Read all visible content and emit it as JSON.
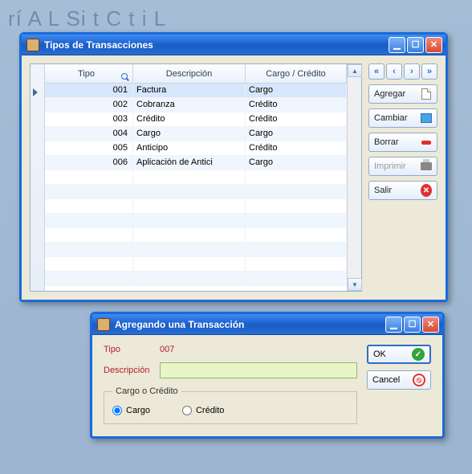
{
  "backdrop": "rí  A           L          Si t              C       t  i      L",
  "list_window": {
    "title": "Tipos de Transacciones",
    "columns": {
      "tipo": "Tipo",
      "descripcion": "Descripción",
      "cargo": "Cargo / Crédito"
    },
    "rows": [
      {
        "tipo": "001",
        "desc": "Factura",
        "cargo": "Cargo"
      },
      {
        "tipo": "002",
        "desc": "Cobranza",
        "cargo": "Crédito"
      },
      {
        "tipo": "003",
        "desc": "Crédito",
        "cargo": "Crédito"
      },
      {
        "tipo": "004",
        "desc": "Cargo",
        "cargo": "Cargo"
      },
      {
        "tipo": "005",
        "desc": "Anticipo",
        "cargo": "Crédito"
      },
      {
        "tipo": "006",
        "desc": "Aplicación de Antici",
        "cargo": "Cargo"
      }
    ],
    "buttons": {
      "agregar": "Agregar",
      "cambiar": "Cambiar",
      "borrar": "Borrar",
      "imprimir": "Imprimir",
      "salir": "Salir"
    }
  },
  "dialog": {
    "title": "Agregando una Transacción",
    "labels": {
      "tipo": "Tipo",
      "descripcion": "Descripción",
      "group": "Cargo o Crédito"
    },
    "tipo_value": "007",
    "descripcion_value": "",
    "radio": {
      "cargo": "Cargo",
      "credito": "Crédito"
    },
    "radio_selected": "cargo",
    "buttons": {
      "ok": "OK",
      "cancel": "Cancel"
    }
  }
}
